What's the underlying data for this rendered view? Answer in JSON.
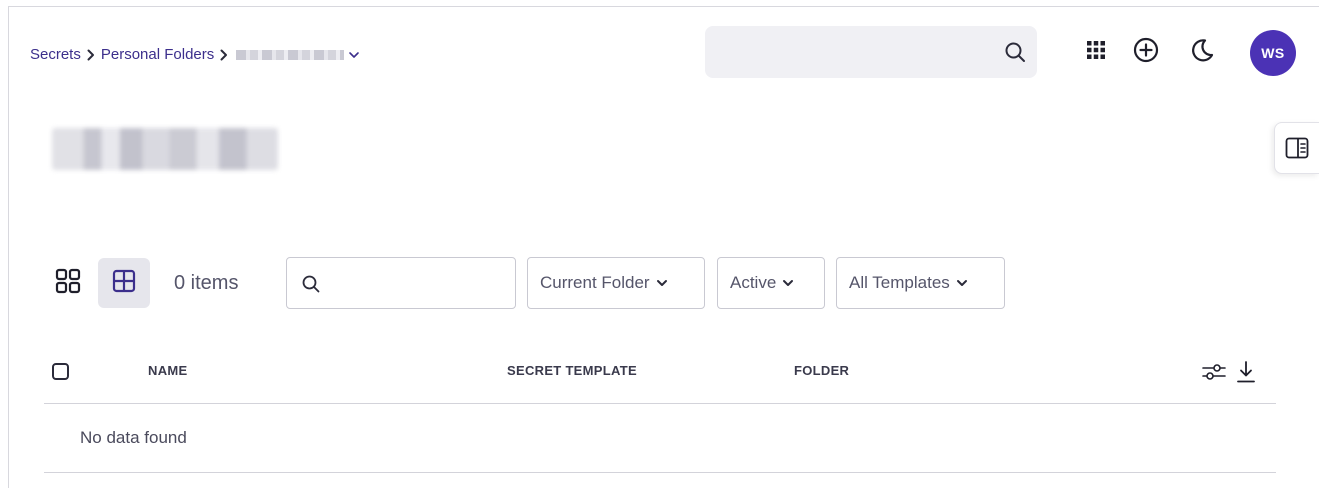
{
  "breadcrumb": {
    "items": [
      "Secrets",
      "Personal Folders"
    ]
  },
  "header": {
    "search_placeholder": "",
    "avatar_initials": "WS"
  },
  "toolbar": {
    "item_count": "0 items",
    "search_placeholder": "",
    "filters": [
      "Current Folder",
      "Active",
      "All Templates"
    ]
  },
  "table": {
    "columns": [
      "NAME",
      "SECRET TEMPLATE",
      "FOLDER"
    ],
    "empty_message": "No data found"
  },
  "colors": {
    "accent": "#4b32b5",
    "link": "#3c2f8c"
  }
}
